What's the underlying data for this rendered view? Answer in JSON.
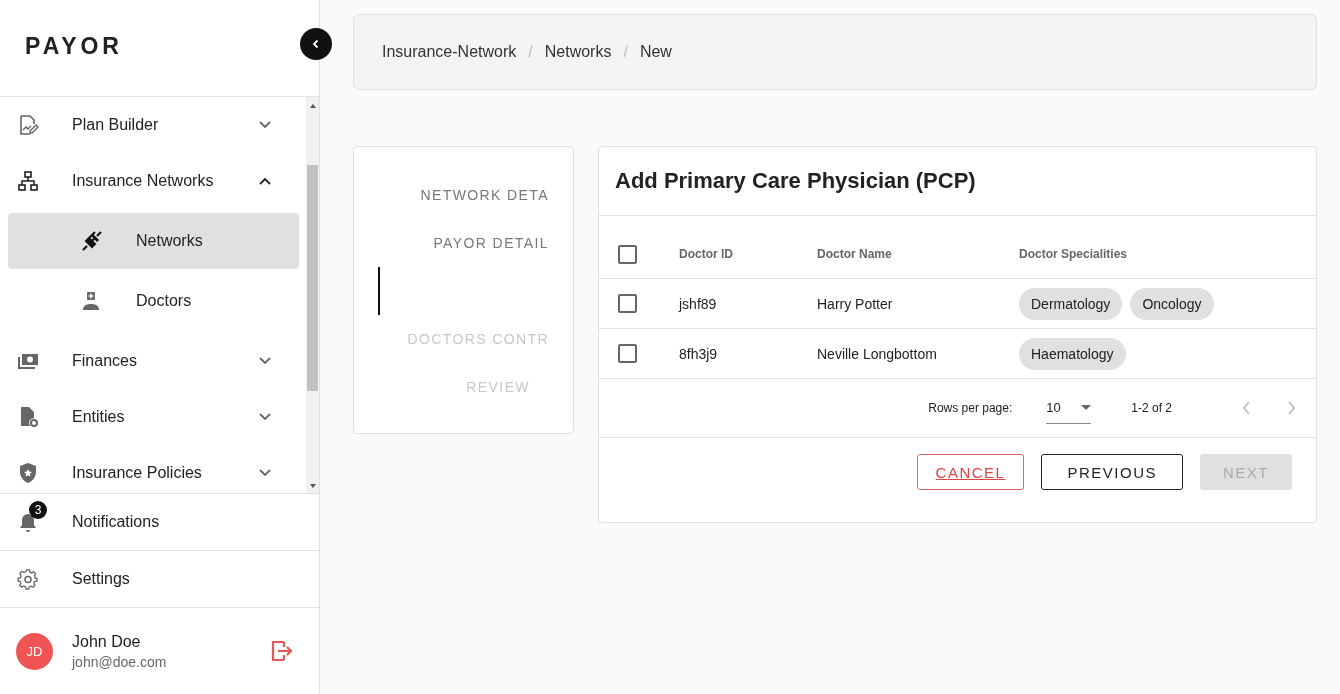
{
  "logo": "PAYOR",
  "nav": [
    {
      "label": "Plan Builder",
      "expanded": false
    },
    {
      "label": "Insurance Networks",
      "expanded": true,
      "children": [
        {
          "label": "Networks",
          "selected": true
        },
        {
          "label": "Doctors",
          "selected": false
        }
      ]
    },
    {
      "label": "Finances",
      "expanded": false
    },
    {
      "label": "Entities",
      "expanded": false
    },
    {
      "label": "Insurance Policies",
      "expanded": false
    }
  ],
  "notifications": {
    "label": "Notifications",
    "count": "3"
  },
  "settings": {
    "label": "Settings"
  },
  "user": {
    "initials": "JD",
    "name": "John Doe",
    "email": "john@doe.com"
  },
  "breadcrumbs": [
    {
      "kind": "link",
      "text": "Insurance-Network"
    },
    {
      "kind": "separator",
      "text": "/"
    },
    {
      "kind": "link",
      "text": "Networks"
    },
    {
      "kind": "separator",
      "text": "/"
    },
    {
      "kind": "current",
      "text": "New"
    }
  ],
  "steps": [
    {
      "label": "NETWORK DETA",
      "selected": false,
      "disabled": false
    },
    {
      "label": "PAYOR DETAIL",
      "selected": false,
      "disabled": false
    },
    {
      "selected": true
    },
    {
      "label": "DOCTORS CONTR",
      "selected": false,
      "disabled": true
    },
    {
      "label": "REVIEW",
      "selected": false,
      "disabled": true
    }
  ],
  "card": {
    "title": "Add Primary Care Physician (PCP)",
    "select_all": {
      "checked": false
    },
    "columns": [
      "Doctor ID",
      "Doctor Name",
      "Doctor Specialities"
    ],
    "rows": [
      {
        "checked": false,
        "id": "jshf89",
        "name": "Harry Potter",
        "specialities": [
          "Dermatology",
          "Oncology"
        ]
      },
      {
        "checked": false,
        "id": "8fh3j9",
        "name": "Neville Longbottom",
        "specialities": [
          "Haematology"
        ]
      }
    ],
    "pagination": {
      "rows_label": "Rows per page:",
      "rows_value": "10",
      "range": "1-2 of 2"
    },
    "buttons": [
      {
        "label": "CANCEL",
        "kind": "cancel"
      },
      {
        "label": "PREVIOUS",
        "kind": "outline"
      },
      {
        "label": "NEXT",
        "kind": "primary",
        "disabled": true
      }
    ]
  }
}
